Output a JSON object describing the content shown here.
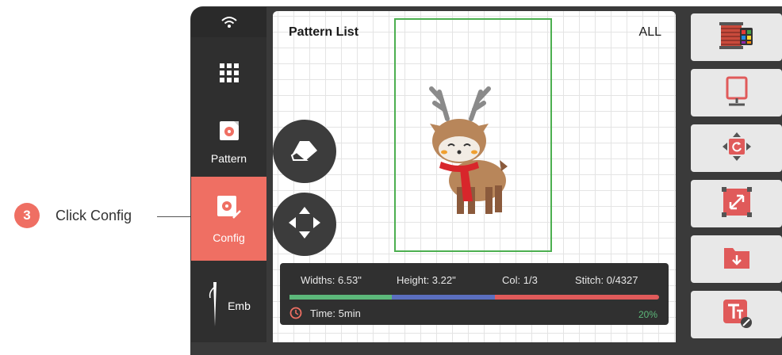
{
  "callout": {
    "number": "3",
    "text": "Click Config"
  },
  "sidebar": {
    "pattern_label": "Pattern",
    "config_label": "Config",
    "emb_label": "Emb"
  },
  "pattern_list": {
    "title": "Pattern List",
    "filter": "ALL"
  },
  "info": {
    "widths": "Widths: 6.53\"",
    "height": "Height: 3.22\"",
    "color": "Col: 1/3",
    "stitch": "Stitch: 0/4327",
    "time": "Time: 5min",
    "percent": "20%",
    "progress_fraction": 0.2,
    "segments": [
      "#5cb87a",
      "#5b6fbf",
      "#e05a5a"
    ]
  },
  "colors": {
    "accent": "#ef6f63",
    "hoop": "#4caf50"
  },
  "toolbar": [
    "thread-colors-icon",
    "hoop-frame-icon",
    "rotate-icon",
    "resize-icon",
    "import-folder-icon",
    "text-edit-icon"
  ]
}
